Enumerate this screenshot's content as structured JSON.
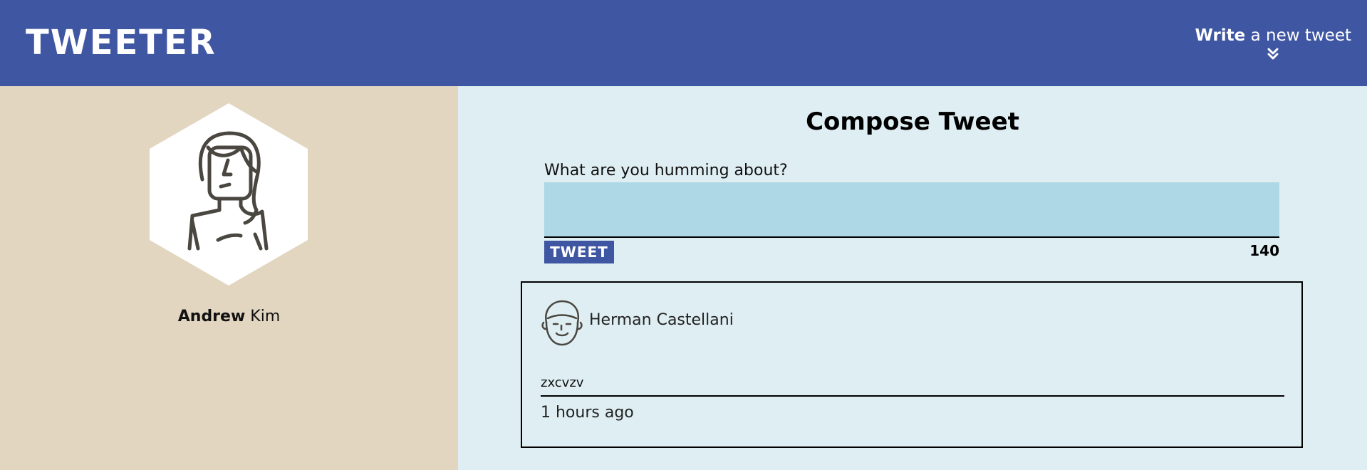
{
  "nav": {
    "brand": "TWEETER",
    "compose_toggle_bold": "Write",
    "compose_toggle_rest": " a new tweet",
    "compose_toggle_icon": "double-chevron-down-icon"
  },
  "profile": {
    "avatar_icon": "female-user-avatar-icon",
    "first_name": "Andrew",
    "last_name": " Kim"
  },
  "compose": {
    "title": "Compose Tweet",
    "label": "What are you humming about?",
    "textarea_value": "",
    "button_label": "TWEET",
    "counter": "140"
  },
  "tweets": [
    {
      "avatar_icon": "male-user-avatar-icon",
      "author": "Herman Castellani",
      "content": "zxcvzv",
      "timestamp": "1 hours ago"
    }
  ],
  "colors": {
    "nav_bg": "#3f56a3",
    "profile_bg": "#e2d6c1",
    "main_bg": "#dfeef3",
    "textarea_bg": "#aed8e5",
    "icon_stroke": "#4a4640"
  }
}
